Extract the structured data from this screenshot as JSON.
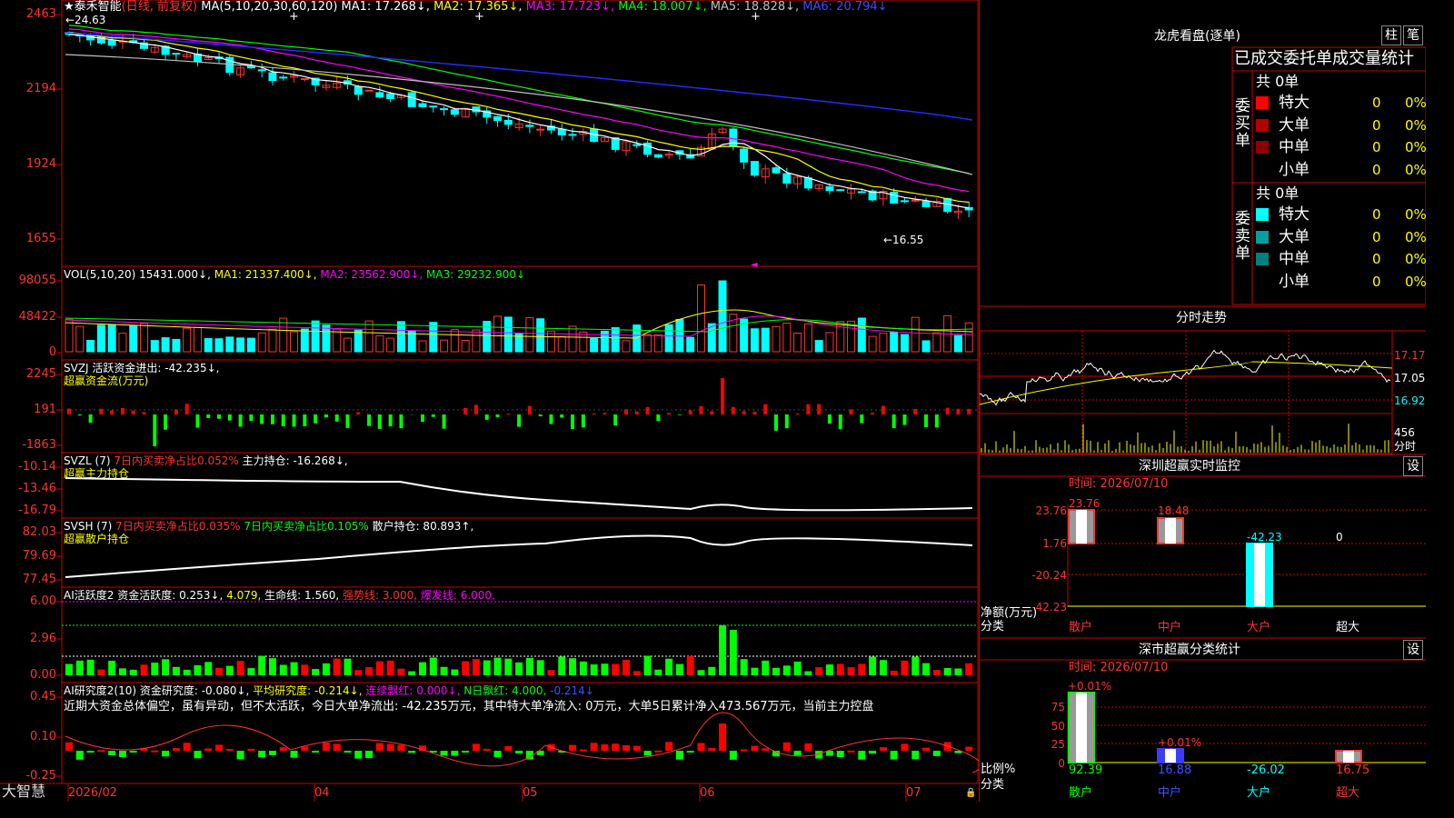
{
  "chart": {
    "stock_name": "泰禾智能",
    "mode": "(日线, 前复权)",
    "ma_label": "MA(5,10,20,30,60,120)",
    "ma1": "MA1: 17.268↓,",
    "ma2": "MA2: 17.365↓,",
    "ma3": "MA3: 17.723↓,",
    "ma4": "MA4: 18.007↓,",
    "ma5": "MA5: 18.828↓,",
    "ma6": "MA6: 20.794↓",
    "high_mark": "←24.63",
    "low_mark": "←16.55",
    "price_axis": [
      "2463",
      "2194",
      "1924",
      "1655"
    ]
  },
  "vol": {
    "label": "VOL(5,10,20)",
    "value": "15431.000↓,",
    "ma1": "MA1: 21337.400↓,",
    "ma2": "MA2: 23562.900↓,",
    "ma3": "MA3: 29232.900↓",
    "axis": [
      "98055",
      "48422",
      "0"
    ]
  },
  "svzj": {
    "title": "SVZJ  活跃资金进出: -42.235↓,",
    "sub": "超赢资金流(万元)",
    "axis": [
      "2245",
      "191",
      "-1863"
    ]
  },
  "svzl": {
    "name": "SVZL (7)",
    "ratio": "7日内买卖净占比0.052%",
    "hold": "主力持仓: -16.268↓,",
    "sub": "超赢主力持仓",
    "axis": [
      "-10.14",
      "-13.46",
      "-16.79"
    ]
  },
  "svsh": {
    "name": "SVSH (7)",
    "ratio1": "7日内买卖净占比0.035%",
    "ratio2": "7日内买卖净占比0.105%",
    "hold": "散户持仓: 80.893↑,",
    "sub": "超赢散户持仓",
    "axis": [
      "82.03",
      "79.69",
      "77.45"
    ]
  },
  "ai_active": {
    "name": "AI活跃度2",
    "a": "资金活跃度: 0.253↓,",
    "b": "4.079,",
    "c": "生命线: 1.560,",
    "d": "强势线: 3.000,",
    "e": "爆发线: 6.000,",
    "axis": [
      "6.00",
      "2.96",
      "0.00"
    ]
  },
  "ai_research": {
    "name": "AI研究度2(10)",
    "a": "资金研究度: -0.080↓,",
    "b": "平均研究度: -0.214↓,",
    "c": "连续飘红: 0.000↓,",
    "d": "N日飘红: 4.000,",
    "e": "-0.214↓",
    "comment": "近期大资金总体偏空，虽有异动，但不太活跃，今日大单净流出: -42.235万元，其中特大单净流入: 0万元，大单5日累计净入473.567万元，当前主力控盘",
    "axis": [
      "0.45",
      "0.10",
      "-0.25"
    ]
  },
  "bottom": {
    "brand": "大智慧",
    "dates": [
      "2026/02",
      "04",
      "05",
      "06",
      "07"
    ]
  },
  "lhb": {
    "title": "龙虎看盘(逐单)",
    "btn1": "柱",
    "btn2": "笔",
    "header": "已成交委托单成交量统计",
    "buy_label": "委买单",
    "sell_label": "委卖单",
    "buy_total": "共 0单",
    "sell_total": "共 0单",
    "rows": [
      {
        "name": "特大",
        "val": "0",
        "pct": "0%"
      },
      {
        "name": "大单",
        "val": "0",
        "pct": "0%"
      },
      {
        "name": "中单",
        "val": "0",
        "pct": "0%"
      },
      {
        "name": "小单",
        "val": "0",
        "pct": "0%"
      }
    ],
    "colors_buy": [
      "#ff0000",
      "#b40000",
      "#8c0000"
    ],
    "colors_sell": [
      "#00ffff",
      "#00a0a0",
      "#008080"
    ]
  },
  "intraday": {
    "title": "分时走势",
    "axis": [
      "17.17",
      "17.05",
      "16.92"
    ],
    "vol_label": "456",
    "vol_unit": "分时"
  },
  "sz_monitor": {
    "title": "深圳超赢实时监控",
    "btn": "设",
    "time": "时间: 2026/07/10",
    "axis": [
      "23.76",
      "1.76",
      "-20.24",
      "-42.23"
    ],
    "values": [
      "23.76",
      "18.48",
      "-42.23",
      "0"
    ],
    "unit": "净额(万元)",
    "cat_label": "分类",
    "cats": [
      "散户",
      "中户",
      "大户",
      "超大"
    ]
  },
  "sz_class": {
    "title": "深市超赢分类统计",
    "btn": "设",
    "time": "时间: 2026/07/10",
    "axis": [
      "75",
      "50",
      "25",
      "0"
    ],
    "top_labels": [
      "+0.01%",
      "+0.01%"
    ],
    "values": [
      "92.39",
      "16.88",
      "-26.02",
      "16.75"
    ],
    "unit": "比例%",
    "cat_label": "分类",
    "cats": [
      "散户",
      "中户",
      "大户",
      "超大"
    ]
  }
}
